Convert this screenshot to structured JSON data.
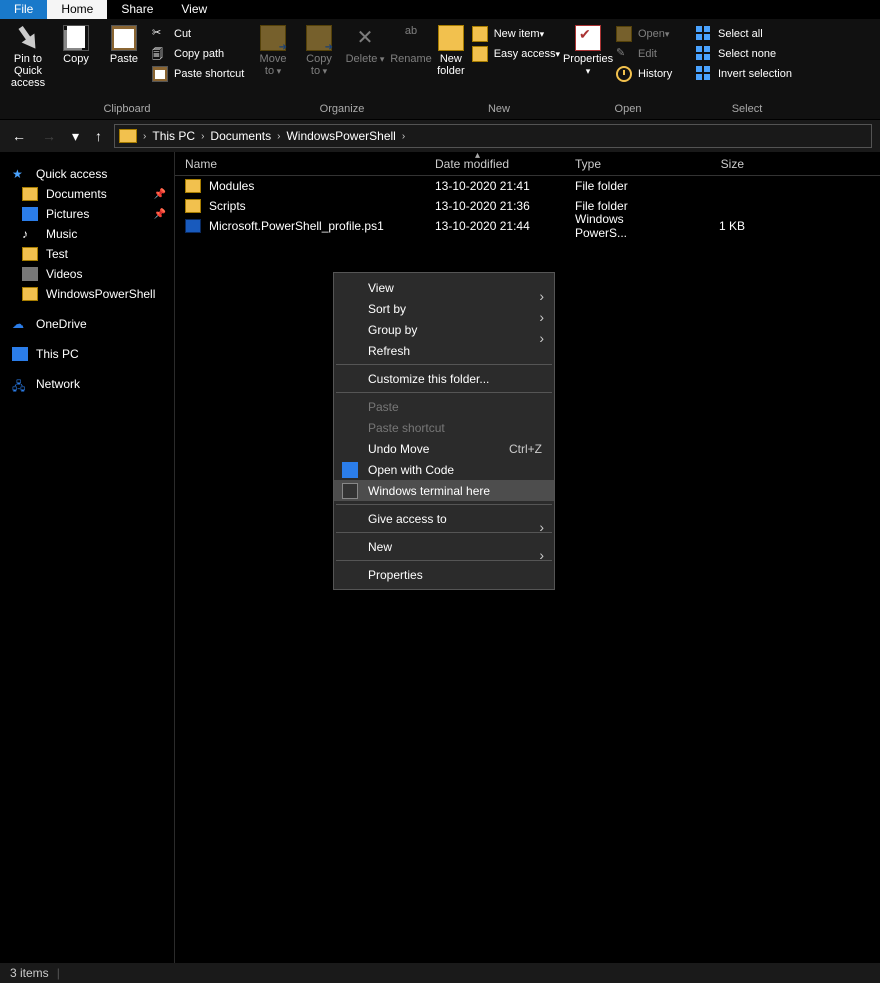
{
  "tabs": {
    "file": "File",
    "home": "Home",
    "share": "Share",
    "view": "View"
  },
  "ribbon": {
    "pin": "Pin to Quick\naccess",
    "copy": "Copy",
    "paste": "Paste",
    "cut": "Cut",
    "copypath": "Copy path",
    "pasteshort": "Paste shortcut",
    "moveto": "Move\nto",
    "copyto": "Copy\nto",
    "delete": "Delete",
    "rename": "Rename",
    "newfolder": "New\nfolder",
    "newitem": "New item",
    "easy": "Easy access",
    "properties": "Properties",
    "open": "Open",
    "edit": "Edit",
    "history": "History",
    "selall": "Select all",
    "selnone": "Select none",
    "selinv": "Invert selection",
    "groups": {
      "clipboard": "Clipboard",
      "organize": "Organize",
      "new": "New",
      "open": "Open",
      "select": "Select"
    }
  },
  "breadcrumb": [
    "This PC",
    "Documents",
    "WindowsPowerShell"
  ],
  "sidebar": {
    "quick": "Quick access",
    "items": [
      "Documents",
      "Pictures",
      "Music",
      "Test",
      "Videos",
      "WindowsPowerShell"
    ],
    "onedrive": "OneDrive",
    "thispc": "This PC",
    "network": "Network"
  },
  "columns": {
    "name": "Name",
    "date": "Date modified",
    "type": "Type",
    "size": "Size"
  },
  "rows": [
    {
      "name": "Modules",
      "date": "13-10-2020 21:41",
      "type": "File folder",
      "size": "",
      "icon": "folder"
    },
    {
      "name": "Scripts",
      "date": "13-10-2020 21:36",
      "type": "File folder",
      "size": "",
      "icon": "folder"
    },
    {
      "name": "Microsoft.PowerShell_profile.ps1",
      "date": "13-10-2020 21:44",
      "type": "Windows PowerS...",
      "size": "1 KB",
      "icon": "ps1"
    }
  ],
  "ctx": {
    "view": "View",
    "sort": "Sort by",
    "group": "Group by",
    "refresh": "Refresh",
    "customize": "Customize this folder...",
    "paste": "Paste",
    "pasteshort": "Paste shortcut",
    "undo": "Undo Move",
    "undo_accel": "Ctrl+Z",
    "openwithcode": "Open with Code",
    "wterm": "Windows terminal here",
    "giveaccess": "Give access to",
    "new": "New",
    "properties": "Properties"
  },
  "status": {
    "items": "3 items"
  }
}
